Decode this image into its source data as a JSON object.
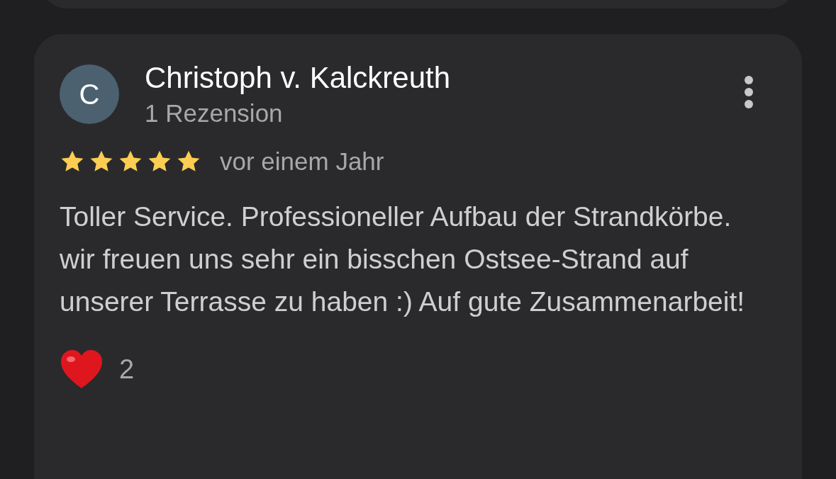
{
  "review": {
    "avatar_letter": "C",
    "author": "Christoph v. Kalckreuth",
    "author_meta": "1 Rezension",
    "stars": 5,
    "time": "vor einem Jahr",
    "text": "Toller Service. Professioneller Aufbau der Strandkörbe. wir freuen uns sehr ein bisschen Ostsee-Strand auf unserer Terrasse zu haben :) Auf gute Zusammenarbeit!",
    "reaction_count": "2"
  }
}
